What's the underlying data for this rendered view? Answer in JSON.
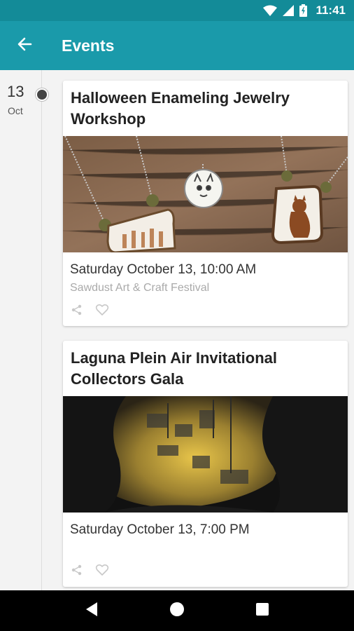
{
  "status_bar": {
    "time": "11:41",
    "icons": [
      "wifi-icon",
      "cell-signal-icon",
      "battery-icon"
    ]
  },
  "app_bar": {
    "title": "Events",
    "back_icon": "arrow-left-icon"
  },
  "date_marker": {
    "day": "13",
    "month": "Oct"
  },
  "events": [
    {
      "title": "Halloween Enameling Jewelry Workshop",
      "image": "enamel-necklaces-photo",
      "datetime": "Saturday October 13, 10:00 AM",
      "venue": "Sawdust Art & Craft Festival",
      "actions": [
        "share-icon",
        "heart-icon"
      ]
    },
    {
      "title": "Laguna Plein Air Invitational Collectors Gala",
      "image": "harbor-painting-photo",
      "datetime": "Saturday October 13, 7:00 PM",
      "venue": "",
      "actions": [
        "share-icon",
        "heart-icon"
      ]
    }
  ],
  "nav_bar": {
    "buttons": [
      "back-triangle-icon",
      "home-circle-icon",
      "recents-square-icon"
    ]
  },
  "colors": {
    "status_bar": "#138b98",
    "app_bar": "#1a9aaa",
    "background": "#f3f3f3"
  }
}
